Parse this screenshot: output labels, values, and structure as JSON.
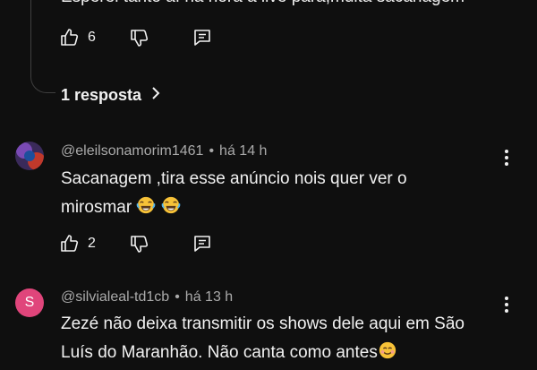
{
  "previous_comment": {
    "text_partial": "Esperei tanto aí na hora a live para,muita sacanagem",
    "likes": "6",
    "replies_label": "1 resposta"
  },
  "comments": [
    {
      "author": "@eleilsonamorim1461",
      "time": "há 14 h",
      "text": "Sacanagem ,tira esse anúncio nois quer ver o",
      "text_line2": "mirosmar",
      "emojis": [
        "face-with-tears-of-joy",
        "face-with-tears-of-joy"
      ],
      "likes": "2"
    },
    {
      "author": "@silvialeal-td1cb",
      "time": "há 13 h",
      "avatar_letter": "S",
      "avatar_color": "#e0457b",
      "text": "Zezé não deixa transmitir os shows dele aqui em São",
      "text_line2": "Luís do Maranhão. Não canta como antes",
      "emojis": [
        "smiling-face-with-smiling-eyes"
      ]
    }
  ],
  "icons": {
    "like": "thumbs-up-icon",
    "dislike": "thumbs-down-icon",
    "reply": "reply-icon",
    "more": "more-vertical-icon",
    "chevron": "chevron-right-icon"
  },
  "colors": {
    "background": "#0f0f0f",
    "text": "#f1f1f1",
    "muted": "#aaaaaa",
    "avatar_s": "#e0457b"
  },
  "separator": "•"
}
